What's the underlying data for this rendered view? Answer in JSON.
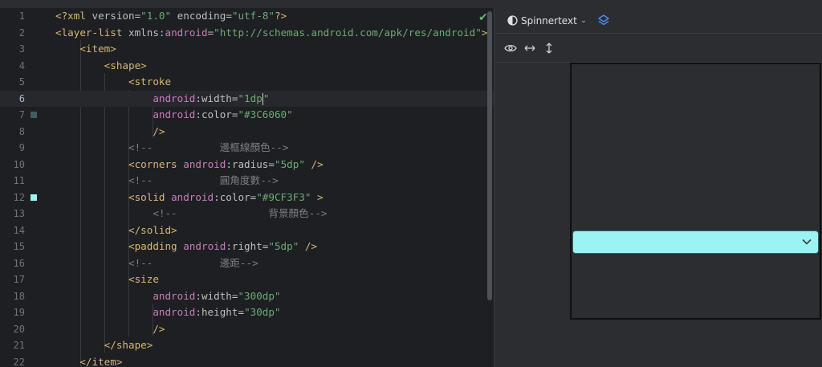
{
  "editor": {
    "current_line": 6,
    "lines": [
      {
        "n": "1",
        "tokens": [
          [
            "tag",
            "<?xml "
          ],
          [
            "attr",
            "version="
          ],
          [
            "str",
            "\"1.0\""
          ],
          [
            "attr",
            " encoding="
          ],
          [
            "str",
            "\"utf-8\""
          ],
          [
            "tag",
            "?>"
          ]
        ]
      },
      {
        "n": "2",
        "tokens": [
          [
            "tag",
            "<layer-list "
          ],
          [
            "attr",
            "xmlns:"
          ],
          [
            "ns",
            "android"
          ],
          [
            "attr",
            "="
          ],
          [
            "str",
            "\"http://schemas.android.com/apk/res/android\""
          ],
          [
            "tag",
            ">"
          ]
        ]
      },
      {
        "n": "3",
        "tokens": [
          [
            "tag",
            "    <item>"
          ]
        ]
      },
      {
        "n": "4",
        "tokens": [
          [
            "tag",
            "        <shape>"
          ]
        ]
      },
      {
        "n": "5",
        "tokens": [
          [
            "tag",
            "            <stroke"
          ]
        ]
      },
      {
        "n": "6",
        "tokens": [
          [
            "ns",
            "                android"
          ],
          [
            "attr",
            ":width="
          ],
          [
            "str",
            "\"1dp"
          ],
          [
            "caret",
            ""
          ],
          [
            "str",
            "\""
          ]
        ]
      },
      {
        "n": "7",
        "tokens": [
          [
            "ns",
            "                android"
          ],
          [
            "attr",
            ":color="
          ],
          [
            "str",
            "\"#3C6060\""
          ]
        ]
      },
      {
        "n": "8",
        "tokens": [
          [
            "tag",
            "                />"
          ]
        ]
      },
      {
        "n": "9",
        "tokens": [
          [
            "comment",
            "            <!--           邊框線顏色-->"
          ]
        ]
      },
      {
        "n": "10",
        "tokens": [
          [
            "tag",
            "            <corners "
          ],
          [
            "ns",
            "android"
          ],
          [
            "attr",
            ":radius="
          ],
          [
            "str",
            "\"5dp\""
          ],
          [
            "tag",
            " />"
          ]
        ]
      },
      {
        "n": "11",
        "tokens": [
          [
            "comment",
            "            <!--           圓角度數-->"
          ]
        ]
      },
      {
        "n": "12",
        "tokens": [
          [
            "tag",
            "            <solid "
          ],
          [
            "ns",
            "android"
          ],
          [
            "attr",
            ":color="
          ],
          [
            "str",
            "\"#9CF3F3\""
          ],
          [
            "tag",
            " >"
          ]
        ]
      },
      {
        "n": "13",
        "tokens": [
          [
            "comment",
            "                <!--               背景顏色-->"
          ]
        ]
      },
      {
        "n": "14",
        "tokens": [
          [
            "tag",
            "            </solid>"
          ]
        ]
      },
      {
        "n": "15",
        "tokens": [
          [
            "tag",
            "            <padding "
          ],
          [
            "ns",
            "android"
          ],
          [
            "attr",
            ":right="
          ],
          [
            "str",
            "\"5dp\""
          ],
          [
            "tag",
            " />"
          ]
        ]
      },
      {
        "n": "16",
        "tokens": [
          [
            "comment",
            "            <!--           邊距-->"
          ]
        ]
      },
      {
        "n": "17",
        "tokens": [
          [
            "tag",
            "            <size"
          ]
        ]
      },
      {
        "n": "18",
        "tokens": [
          [
            "ns",
            "                android"
          ],
          [
            "attr",
            ":width="
          ],
          [
            "str",
            "\"300dp\""
          ]
        ]
      },
      {
        "n": "19",
        "tokens": [
          [
            "ns",
            "                android"
          ],
          [
            "attr",
            ":height="
          ],
          [
            "str",
            "\"30dp\""
          ]
        ]
      },
      {
        "n": "20",
        "tokens": [
          [
            "tag",
            "                />"
          ]
        ]
      },
      {
        "n": "21",
        "tokens": [
          [
            "tag",
            "        </shape>"
          ]
        ]
      },
      {
        "n": "22",
        "tokens": [
          [
            "tag",
            "    </item>"
          ]
        ]
      }
    ],
    "gutter_colors": {
      "7": "#3C6060",
      "12": "#9CF3F3"
    },
    "status_icon": "✔"
  },
  "preview": {
    "theme_label": "Spinnertext",
    "theme_chevron": "⌄",
    "spinner_fill": "#9CF3F3",
    "spinner_stroke": "#3C6060"
  }
}
